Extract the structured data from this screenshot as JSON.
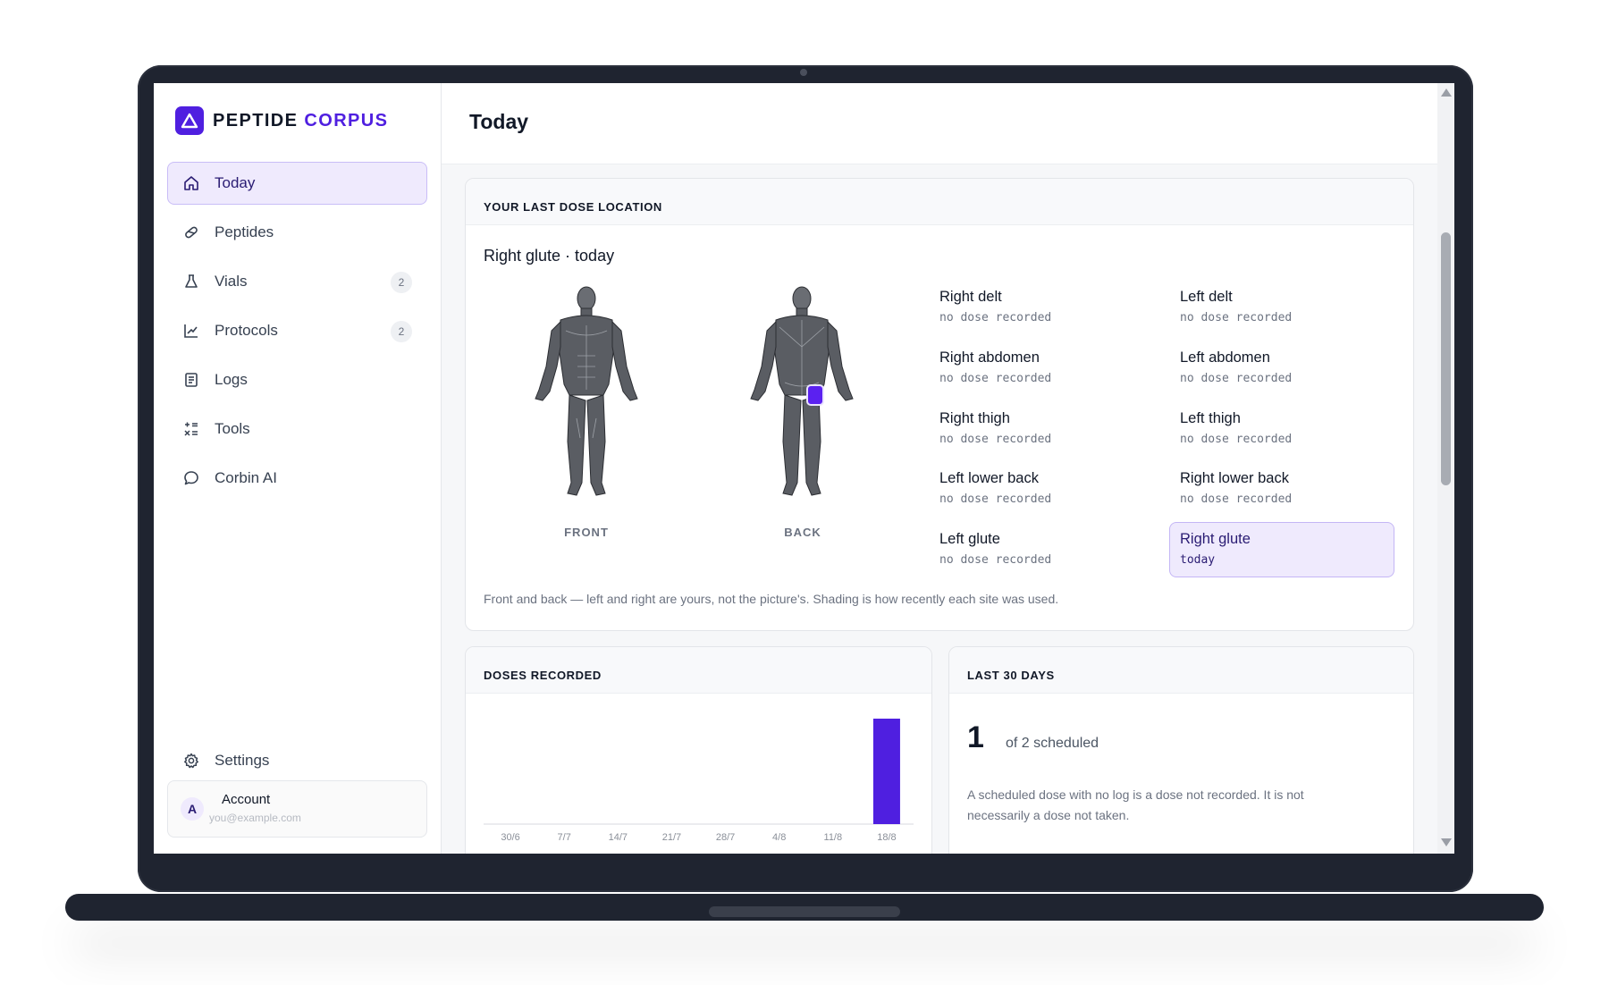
{
  "app": {
    "brand_name": "PEPTIDE",
    "brand_accent": "CORPUS",
    "accent_color": "#4f1fe0"
  },
  "sidebar": {
    "items": [
      {
        "label": "Today",
        "icon": "home-icon",
        "active": true
      },
      {
        "label": "Peptides",
        "icon": "pill-icon"
      },
      {
        "label": "Vials",
        "icon": "flask-icon",
        "badge": "2"
      },
      {
        "label": "Protocols",
        "icon": "chart-line-icon",
        "badge": "2"
      },
      {
        "label": "Logs",
        "icon": "document-icon"
      },
      {
        "label": "Tools",
        "icon": "calculator-icon"
      },
      {
        "label": "Corbin AI",
        "icon": "chat-bubble-icon"
      }
    ],
    "settings_label": "Settings",
    "account": {
      "initial": "A",
      "name": "Account",
      "email": "you@example.com"
    }
  },
  "header": {
    "title": "Today"
  },
  "last_dose": {
    "heading": "YOUR LAST DOSE LOCATION",
    "location": "Right glute · today",
    "front_label": "FRONT",
    "back_label": "BACK",
    "sites": [
      {
        "name": "Right delt",
        "status": "no dose recorded"
      },
      {
        "name": "Left delt",
        "status": "no dose recorded"
      },
      {
        "name": "Right abdomen",
        "status": "no dose recorded"
      },
      {
        "name": "Left abdomen",
        "status": "no dose recorded"
      },
      {
        "name": "Right thigh",
        "status": "no dose recorded"
      },
      {
        "name": "Left thigh",
        "status": "no dose recorded"
      },
      {
        "name": "Left lower back",
        "status": "no dose recorded"
      },
      {
        "name": "Right lower back",
        "status": "no dose recorded"
      },
      {
        "name": "Left glute",
        "status": "no dose recorded"
      },
      {
        "name": "Right glute",
        "status": "today",
        "active": true
      }
    ],
    "note": "Front and back — left and right are yours, not the picture's. Shading is how recently each site was used."
  },
  "doses_recorded": {
    "heading": "DOSES RECORDED"
  },
  "chart_data": {
    "type": "bar",
    "categories": [
      "30/6",
      "7/7",
      "14/7",
      "21/7",
      "28/7",
      "4/8",
      "11/8",
      "18/8"
    ],
    "values": [
      0,
      0,
      0,
      0,
      0,
      0,
      0,
      1
    ],
    "ylim": [
      0,
      1
    ],
    "grid": false,
    "bar_color": "#4f1fe0"
  },
  "last_30_days": {
    "heading": "LAST 30 DAYS",
    "count": "1",
    "of_scheduled": "of 2 scheduled",
    "note": "A scheduled dose with no log is a dose not recorded. It is not necessarily a dose not taken."
  }
}
